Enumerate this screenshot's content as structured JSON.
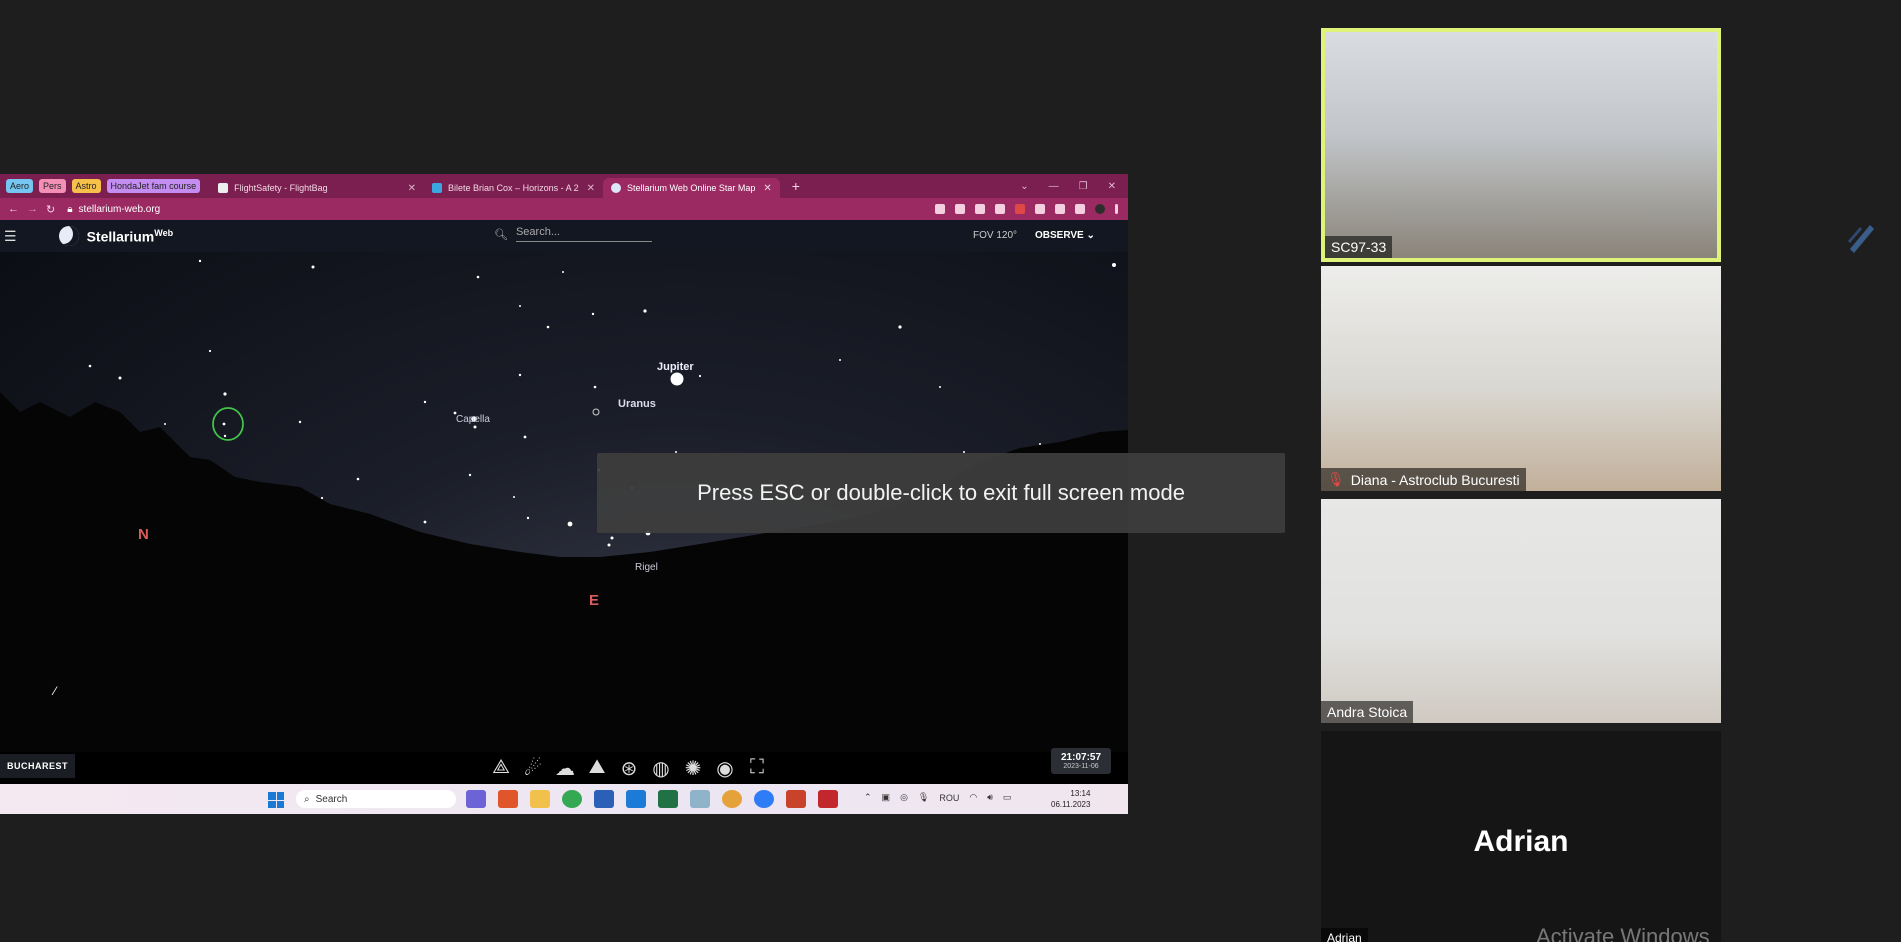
{
  "browser": {
    "bookmarks": [
      {
        "label": "Aero",
        "color": "#76c6f2"
      },
      {
        "label": "Pers",
        "color": "#f48fb6"
      },
      {
        "label": "Astro",
        "color": "#f7c04a"
      },
      {
        "label": "HondaJet fam course",
        "color": "#c48df2"
      }
    ],
    "tabs": [
      {
        "label": "FlightSafety - FlightBag",
        "icon": "document-icon",
        "active": false
      },
      {
        "label": "Bilete Brian Cox – Horizons - A 2",
        "icon": "ticket-site-icon",
        "active": false
      },
      {
        "label": "Stellarium Web Online Star Map",
        "icon": "stellarium-icon",
        "active": true
      }
    ],
    "url": "stellarium-web.org",
    "accent_color": "#9b2a63"
  },
  "stellarium": {
    "logo_text": "Stellarium",
    "logo_sup": "Web",
    "search_placeholder": "Search...",
    "fov_label": "FOV 120°",
    "observe_label": "OBSERVE",
    "labels": {
      "jupiter": "Jupiter",
      "uranus": "Uranus",
      "capella": "Capella",
      "rigel": "Rigel",
      "north": "N",
      "east": "E"
    },
    "location": "BUCHAREST",
    "time": "21:07:57",
    "date": "2023-11-06"
  },
  "taskbar": {
    "search_label": "Search",
    "language": "ROU",
    "time": "13:14",
    "date": "06.11.2023"
  },
  "fullscreen_notice": "Press ESC or double-click to exit full screen mode",
  "participants": [
    {
      "name": "SC97-33",
      "muted": false,
      "active_speaker": true
    },
    {
      "name": "Diana - Astroclub Bucuresti",
      "muted": true,
      "active_speaker": false
    },
    {
      "name": "Andra Stoica",
      "muted": false,
      "active_speaker": false
    },
    {
      "name": "Adrian",
      "muted": false,
      "active_speaker": false,
      "label": "Adrian"
    }
  ],
  "watermark": "Activate Windows"
}
